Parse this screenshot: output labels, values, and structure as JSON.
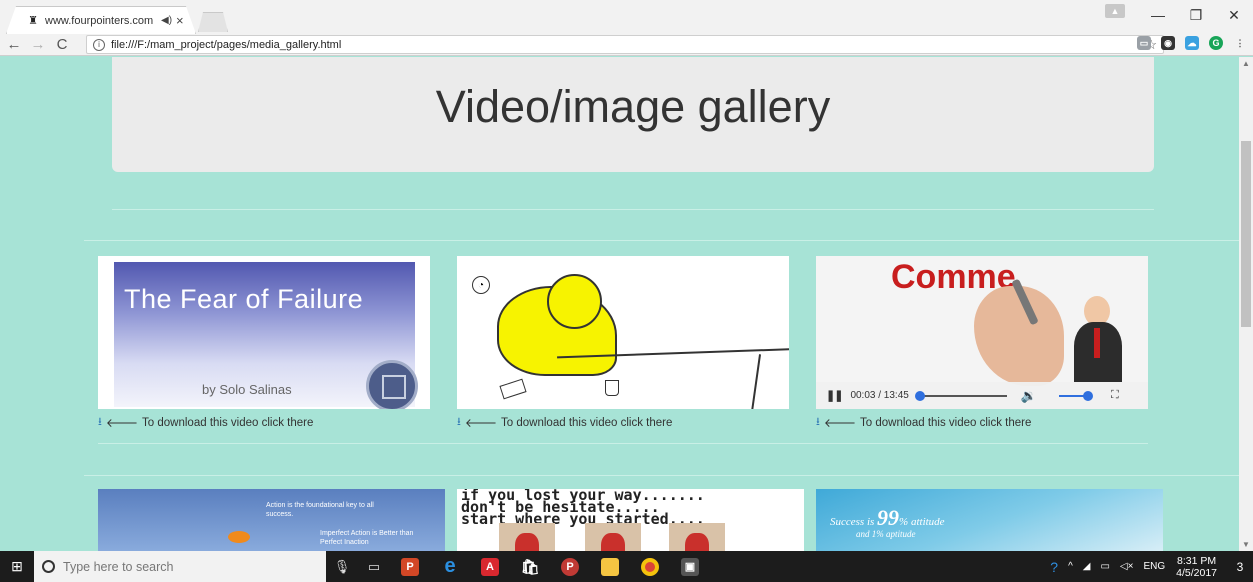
{
  "browser": {
    "tab_title": "www.fourpointers.com",
    "tab_favicon": "fourpointers-logo-icon",
    "url": "file:///F:/mam_project/pages/media_gallery.html"
  },
  "page": {
    "heading": "Video/image gallery",
    "download_text": "To download this video click there",
    "cards_row1": [
      {
        "title": "The Fear of Failure",
        "author": "by Solo Salinas"
      },
      {
        "title": ""
      },
      {
        "title": "Comme"
      }
    ],
    "video": {
      "time": "00:03 / 13:45"
    },
    "cards_row2": [
      {
        "line1": "Action is the foundational key to all success.",
        "line2": "Imperfect Action is Better than Perfect Inaction"
      },
      {
        "text": "if you lost your way.......\ndon't be hesitate.....\nstart where you started...."
      },
      {
        "prefix": "Success is",
        "big": "99",
        "suffix": "% attitude",
        "line2": "and 1% aptitude"
      }
    ]
  },
  "taskbar": {
    "search_placeholder": "Type here to search",
    "lang": "ENG",
    "time": "8:31 PM",
    "date": "4/5/2017",
    "notifications": "3"
  },
  "colors": {
    "page_bg": "#a7e3d6",
    "jumbotron_bg": "#ebebeb",
    "link_icon": "#337ab7",
    "accent_video": "#2f6fde"
  }
}
